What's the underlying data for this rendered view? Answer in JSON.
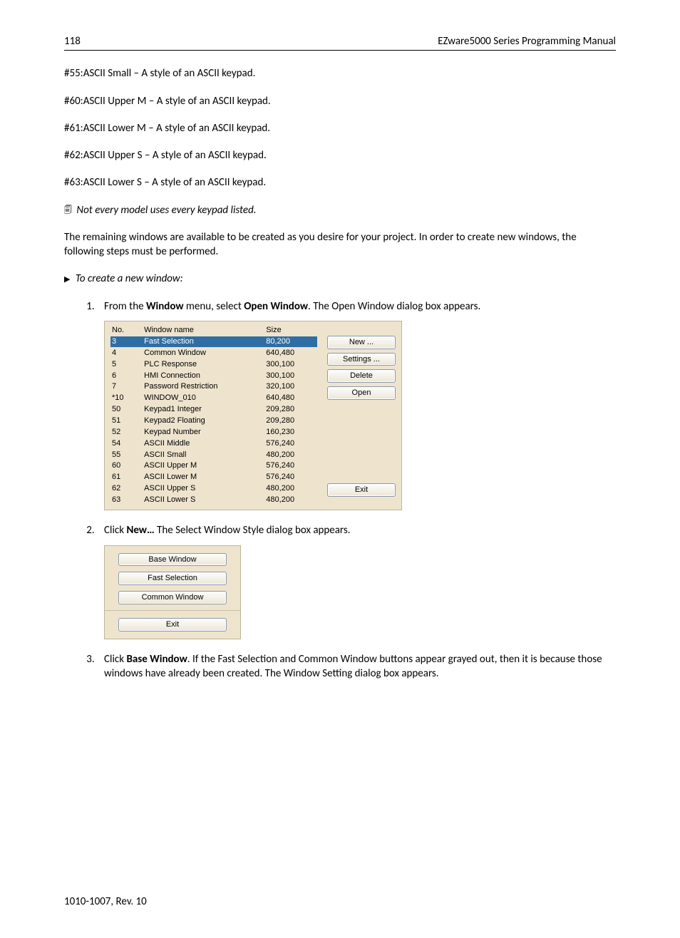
{
  "header": {
    "page_number": "118",
    "manual_title": "EZware5000 Series Programming Manual"
  },
  "paragraphs": {
    "p55": "#55:ASCII Small – A style of an ASCII keypad.",
    "p60": "#60:ASCII Upper M – A style of an ASCII keypad.",
    "p61": "#61:ASCII Lower M – A style of an ASCII keypad.",
    "p62": "#62:ASCII Upper S – A style of an ASCII keypad.",
    "p63": "#63:ASCII Lower S – A style of an ASCII keypad.",
    "note": "Not every model uses every keypad listed.",
    "remaining": "The remaining windows are available to be created as you desire for your project. In order to create new windows, the following steps must be performed.",
    "to_create": "To create a new window:"
  },
  "steps": {
    "s1_a": "From the ",
    "s1_b": "Window",
    "s1_c": " menu, select ",
    "s1_d": "Open Window",
    "s1_e": ". The Open Window dialog box appears.",
    "s2_a": "Click ",
    "s2_b": "New…",
    "s2_c": " The Select Window Style dialog box appears.",
    "s3_a": "Click ",
    "s3_b": "Base Window",
    "s3_c": ". If the Fast Selection and Common Window buttons appear grayed out, then it is because those windows have already been created. The Window Setting dialog box appears."
  },
  "open_window_dialog": {
    "columns": {
      "no": "No.",
      "name": "Window name",
      "size": "Size"
    },
    "rows": [
      {
        "no": "3",
        "name": "Fast Selection",
        "size": "80,200",
        "selected": true
      },
      {
        "no": "4",
        "name": "Common Window",
        "size": "640,480",
        "selected": false
      },
      {
        "no": "5",
        "name": "PLC Response",
        "size": "300,100",
        "selected": false
      },
      {
        "no": "6",
        "name": "HMI Connection",
        "size": "300,100",
        "selected": false
      },
      {
        "no": "7",
        "name": "Password Restriction",
        "size": "320,100",
        "selected": false
      },
      {
        "no": "*10",
        "name": "WINDOW_010",
        "size": "640,480",
        "selected": false
      },
      {
        "no": "50",
        "name": "Keypad1 Integer",
        "size": "209,280",
        "selected": false
      },
      {
        "no": "51",
        "name": "Keypad2 Floating",
        "size": "209,280",
        "selected": false
      },
      {
        "no": "52",
        "name": "Keypad Number",
        "size": "160,230",
        "selected": false
      },
      {
        "no": "54",
        "name": "ASCII Middle",
        "size": "576,240",
        "selected": false
      },
      {
        "no": "55",
        "name": "ASCII Small",
        "size": "480,200",
        "selected": false
      },
      {
        "no": "60",
        "name": "ASCII Upper M",
        "size": "576,240",
        "selected": false
      },
      {
        "no": "61",
        "name": "ASCII Lower M",
        "size": "576,240",
        "selected": false
      },
      {
        "no": "62",
        "name": "ASCII Upper S",
        "size": "480,200",
        "selected": false
      },
      {
        "no": "63",
        "name": "ASCII Lower S",
        "size": "480,200",
        "selected": false
      }
    ],
    "buttons": {
      "new": "New ...",
      "settings": "Settings ...",
      "delete": "Delete",
      "open": "Open",
      "exit": "Exit"
    }
  },
  "style_dialog": {
    "base": "Base Window",
    "fast": "Fast Selection",
    "common": "Common Window",
    "exit": "Exit"
  },
  "footer": {
    "rev": "1010-1007, Rev. 10"
  }
}
